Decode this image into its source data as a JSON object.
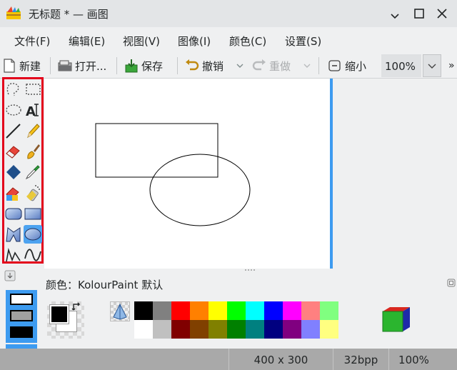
{
  "window": {
    "title": "无标题 * — 画图",
    "minimize_glyph": "🗕",
    "maximize_glyph": "🗖",
    "close_glyph": "✕"
  },
  "menu": {
    "file": "文件(F)",
    "edit": "编辑(E)",
    "view": "视图(V)",
    "image": "图像(I)",
    "colors": "颜色(C)",
    "settings": "设置(S)"
  },
  "toolbar": {
    "new": "新建",
    "open": "打开...",
    "save": "保存",
    "undo": "撤销",
    "redo": "重做",
    "zoom_out": "缩小",
    "zoom_level": "100%",
    "overflow": "»"
  },
  "tools": [
    "free-form-selection",
    "rectangular-selection",
    "elliptical-selection",
    "text",
    "line",
    "pen",
    "eraser",
    "brush",
    "flood-fill",
    "color-picker",
    "color-eraser",
    "spraycan",
    "rounded-rectangle",
    "rectangle",
    "polygon",
    "ellipse",
    "connected-lines",
    "curve"
  ],
  "selected_tool": "ellipse",
  "color_panel": {
    "label_prefix": "颜色：",
    "label_name": "KolourPaint 默认",
    "foreground": "#000000",
    "background": "#ffffff",
    "palette_top": [
      "#000000",
      "#808080",
      "#ff0000",
      "#ff8000",
      "#ffff00",
      "#00ff00",
      "#00ffff",
      "#0000ff",
      "#ff00ff",
      "#ff8080",
      "#80ff80"
    ],
    "palette_bottom": [
      "#ffffff",
      "#c0c0c0",
      "#800000",
      "#804000",
      "#808000",
      "#008000",
      "#008080",
      "#000080",
      "#800080",
      "#8080ff",
      "#ffff80"
    ]
  },
  "status": {
    "size": "400 x 300",
    "depth": "32bpp",
    "zoom": "100%"
  }
}
